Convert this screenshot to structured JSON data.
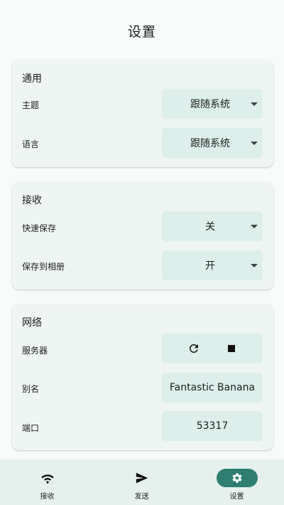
{
  "appbar": {
    "title": "设置"
  },
  "general": {
    "title": "通用",
    "theme": {
      "label": "主题",
      "value": "跟随系统"
    },
    "language": {
      "label": "语言",
      "value": "跟随系统"
    }
  },
  "receive": {
    "title": "接收",
    "quick_save": {
      "label": "快速保存",
      "value": "关"
    },
    "save_to_album": {
      "label": "保存到相册",
      "value": "开"
    }
  },
  "network": {
    "title": "网络",
    "server": {
      "label": "服务器",
      "restart_icon": "refresh-icon",
      "stop_icon": "stop-icon"
    },
    "alias": {
      "label": "别名",
      "value": "Fantastic Banana"
    },
    "port": {
      "label": "端口",
      "value": "53317"
    }
  },
  "bottom_nav": {
    "items": [
      {
        "label": "接收",
        "icon": "wifi-icon"
      },
      {
        "label": "发送",
        "icon": "send-icon"
      },
      {
        "label": "设置",
        "icon": "gear-icon"
      }
    ],
    "active": "设置",
    "accent": "#2e7f72"
  }
}
